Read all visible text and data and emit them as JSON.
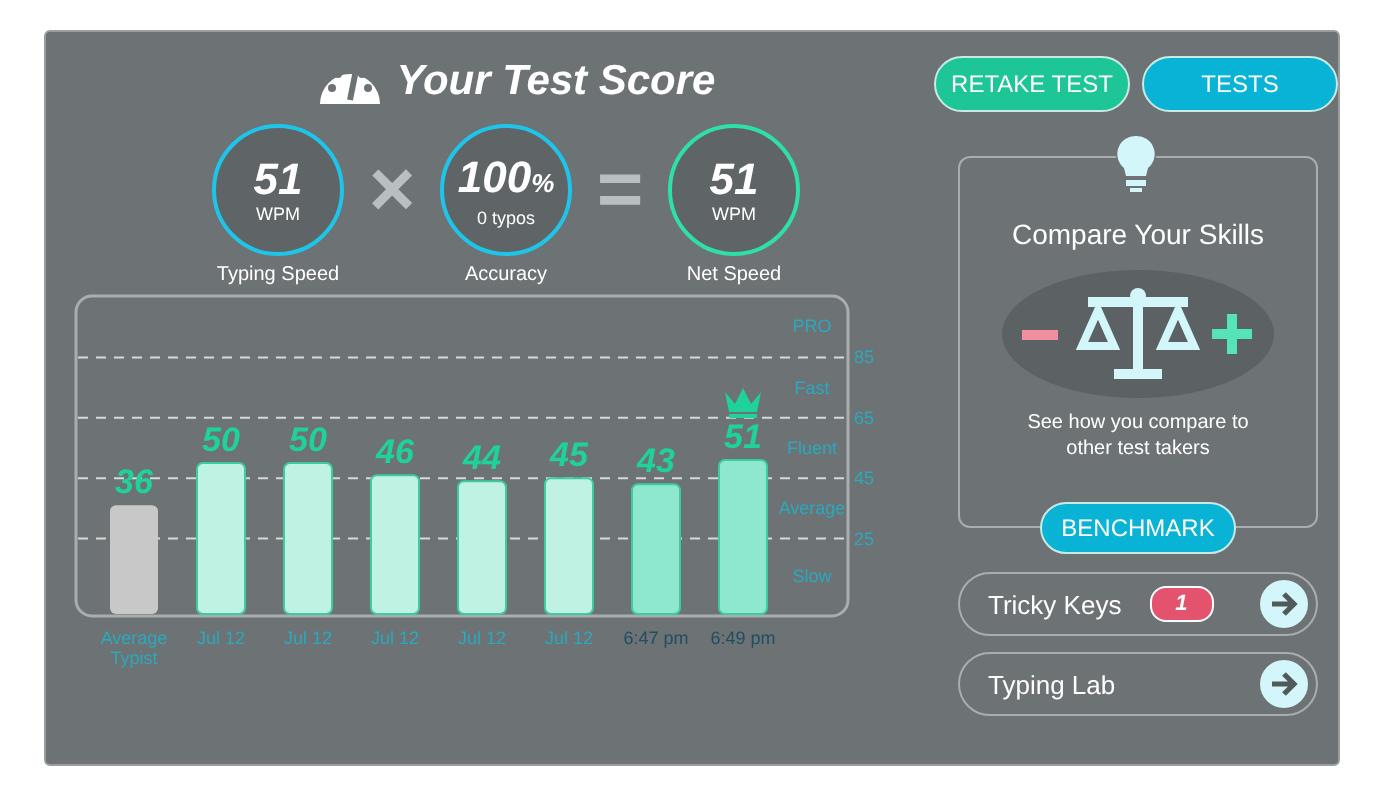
{
  "header": {
    "title": "Your Test Score"
  },
  "scores": [
    {
      "value": "51",
      "unit": "WPM",
      "label": "Typing Speed",
      "kind": "input"
    },
    {
      "value": "100",
      "suffix": "%",
      "unit": "0  typos",
      "label": "Accuracy",
      "kind": "input"
    },
    {
      "value": "51",
      "unit": "WPM",
      "label": "Net Speed",
      "kind": "result"
    }
  ],
  "operators": [
    "×",
    "="
  ],
  "chart_data": {
    "type": "bar",
    "categories": [
      "Average Typist",
      "Jul 12",
      "Jul 12",
      "Jul 12",
      "Jul 12",
      "Jul 12",
      "6:47 pm",
      "6:49 pm"
    ],
    "series": [
      {
        "color": "#c8c8c8",
        "values": [
          36,
          null,
          null,
          null,
          null,
          null,
          null,
          null
        ]
      },
      {
        "color": "#bff2e2",
        "values": [
          null,
          50,
          50,
          46,
          44,
          45,
          null,
          null
        ]
      },
      {
        "color": "#8ee8d0",
        "values": [
          null,
          null,
          null,
          null,
          null,
          null,
          43,
          51
        ]
      }
    ],
    "ylim": [
      0,
      106
    ],
    "yticks": [
      25,
      45,
      65,
      85
    ],
    "data_labels": true,
    "grid": true
  },
  "speed_levels": [
    "PRO",
    "Fast",
    "Fluent",
    "Average",
    "Slow"
  ],
  "actions": [
    {
      "label": "RETAKE TEST",
      "kind": "primary"
    },
    {
      "label": "TESTS",
      "kind": "secondary"
    }
  ],
  "compare": {
    "title": "Compare Your Skills",
    "text": "See how you compare to other test takers",
    "button": "BENCHMARK"
  },
  "links": [
    {
      "label": "Tricky Keys",
      "badge": "1"
    },
    {
      "label": "Typing Lab"
    }
  ]
}
